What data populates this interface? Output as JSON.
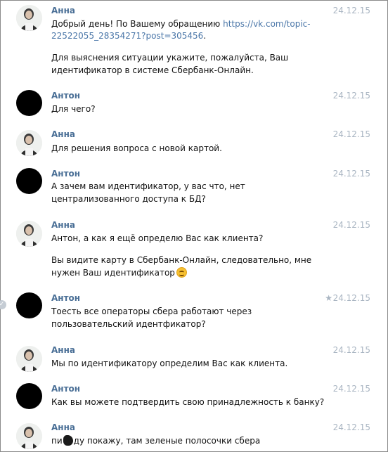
{
  "messages": [
    {
      "author": "Анна",
      "date": "24.12.15",
      "lines": [
        [
          "Добрый день! По Вашему обращению ",
          "https://vk.com/topic-"
        ],
        [
          "22522055_28354271?post=305456",
          "."
        ],
        [
          "Для выяснения ситуации укажите, пожалуйста, Ваш"
        ],
        [
          "идентификатор в системе Сбербанк-Онлайн."
        ]
      ]
    },
    {
      "author": "Антон",
      "date": "24.12.15",
      "lines": [
        [
          "Для чего?"
        ]
      ]
    },
    {
      "author": "Анна",
      "date": "24.12.15",
      "lines": [
        [
          "Для решения вопроса с новой картой."
        ]
      ]
    },
    {
      "author": "Антон",
      "date": "24.12.15",
      "lines": [
        [
          "А зачем вам идентификатор, у вас что, нет"
        ],
        [
          "централизованного доступа к БД?"
        ]
      ]
    },
    {
      "author": "Анна",
      "date": "24.12.15",
      "lines": [
        [
          "Антон, а как я ещё определю Вас как клиента?"
        ],
        [
          "Вы видите карту в Сбербанк-Онлайн, следовательно, мне"
        ],
        [
          "нужен Ваш идентификатор"
        ]
      ]
    },
    {
      "author": "Антон",
      "date": "24.12.15",
      "lines": [
        [
          "Тоесть все операторы сбера работают через"
        ],
        [
          "пользовательский идентфикатор?"
        ]
      ]
    },
    {
      "author": "Анна",
      "date": "24.12.15",
      "lines": [
        [
          "Мы по идентификатору определим Вас как клиента."
        ]
      ]
    },
    {
      "author": "Антон",
      "date": "24.12.15",
      "lines": [
        [
          "Как вы можете подтвердить свою принадлежность к банку?"
        ]
      ]
    },
    {
      "author": "Анна",
      "date": "24.12.15",
      "lines": [
        [
          "пи",
          "ду покажу, там зеленые полосочки сбера"
        ]
      ]
    }
  ],
  "icons": {
    "star": "star-icon",
    "check": "check-circle-icon",
    "emoji": "smile-emoji-icon"
  }
}
